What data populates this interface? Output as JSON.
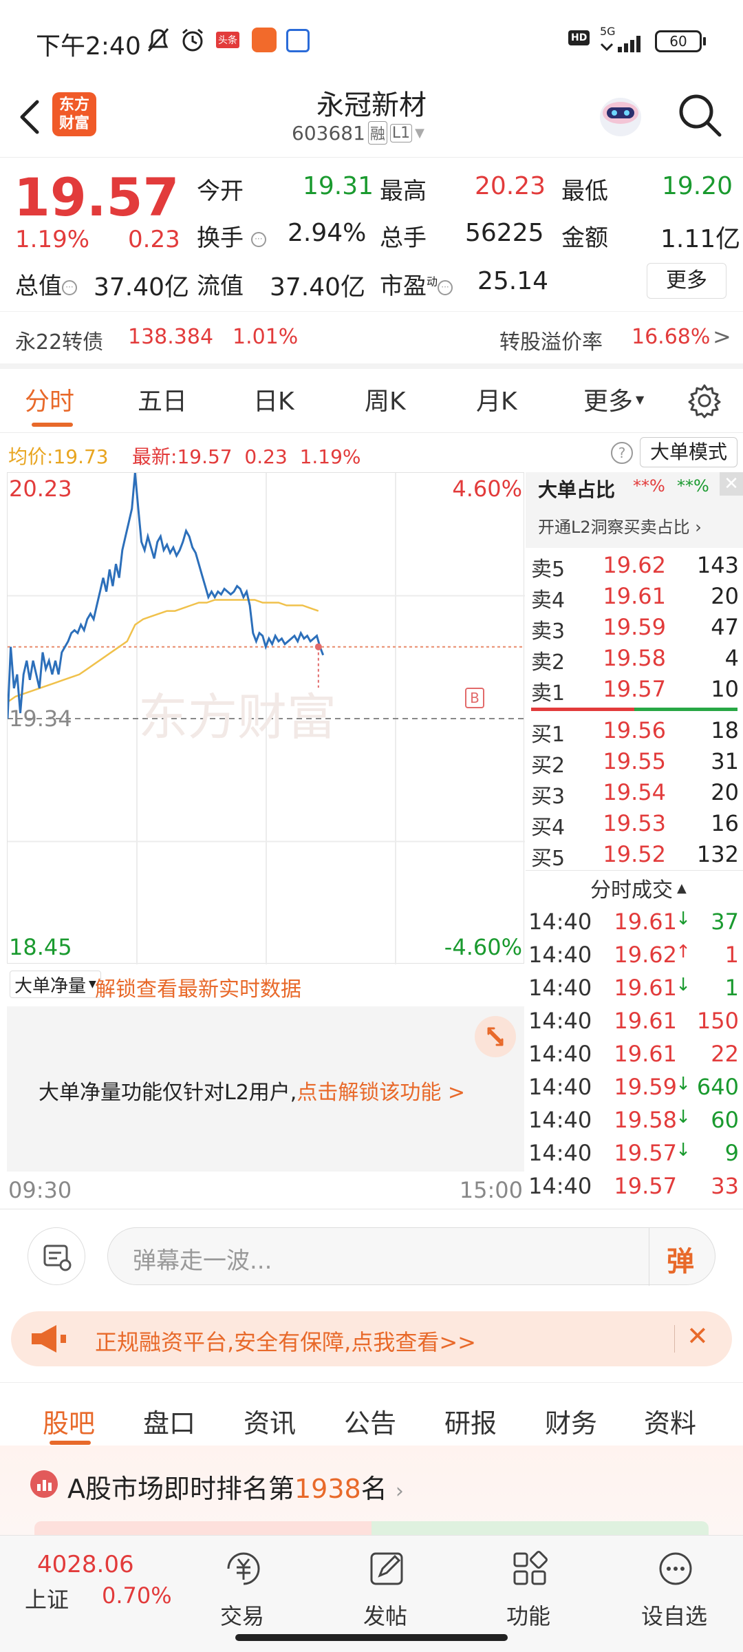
{
  "status_bar": {
    "time": "下午2:40",
    "app_badge1": "头条",
    "battery": "60",
    "network": "5G",
    "hd": "HD"
  },
  "header": {
    "logo_line1": "东方",
    "logo_line2": "财富",
    "title": "永冠新材",
    "code": "603681",
    "tag_rong": "融",
    "tag_l1": "L1"
  },
  "quote": {
    "price": "19.57",
    "change_pct": "1.19%",
    "change_amt": "0.23",
    "open_label": "今开",
    "open": "19.31",
    "high_label": "最高",
    "high": "20.23",
    "low_label": "最低",
    "low": "19.20",
    "turnover_label": "换手",
    "turnover": "2.94%",
    "volume_label": "总手",
    "volume": "56225",
    "amount_label": "金额",
    "amount": "1.11亿",
    "mktcap_label": "总值",
    "mktcap": "37.40亿",
    "float_label": "流值",
    "float": "37.40亿",
    "pe_label": "市盈",
    "pe_sup": "动",
    "pe": "25.14",
    "more_button": "更多"
  },
  "bond": {
    "name": "永22转债",
    "price": "138.384",
    "pct": "1.01%",
    "premium_label": "转股溢价率",
    "premium": "16.68%",
    "arrow": ">"
  },
  "chart_tabs": {
    "items": [
      "分时",
      "五日",
      "日K",
      "周K",
      "月K",
      "更多"
    ],
    "active": 0
  },
  "info_bar": {
    "avg_label": "均价:",
    "avg": "19.73",
    "latest_label": "最新:",
    "latest": "19.57",
    "chg": "0.23",
    "pct": "1.19%",
    "mode_button": "大单模式"
  },
  "intraday": {
    "top_price": "20.23",
    "top_pct": "4.60%",
    "bottom_price": "18.45",
    "bottom_pct": "-4.60%",
    "prev_close": "19.34",
    "start_time": "09:30",
    "end_time": "15:00",
    "watermark": "东方财富",
    "b_marker": "B"
  },
  "chart_data": {
    "type": "line",
    "ylim": [
      18.45,
      20.23
    ],
    "reference_line": 19.34,
    "series": [
      {
        "values": [
          19.34,
          19.6,
          19.45,
          19.5,
          19.36,
          19.5,
          19.55,
          19.48,
          19.55,
          19.5,
          19.45,
          19.58,
          19.52,
          19.55,
          19.5,
          19.55,
          19.5,
          19.58,
          19.6,
          19.62,
          19.65,
          19.66,
          19.65,
          19.68,
          19.66,
          19.7,
          19.72,
          19.7,
          19.75,
          19.8,
          19.85,
          19.8,
          19.88,
          19.82,
          19.9,
          19.85,
          19.95,
          20.0,
          20.05,
          20.1,
          20.23,
          20.1,
          19.98,
          19.95,
          20.0,
          19.96,
          19.92,
          19.98,
          20.0,
          19.95,
          19.97,
          19.94,
          19.96,
          19.93,
          19.95,
          19.98,
          20.02,
          20.0,
          19.96,
          19.94,
          19.9,
          19.86,
          19.82,
          19.78,
          19.8,
          19.78,
          19.8,
          19.79,
          19.81,
          19.8,
          19.79,
          19.8,
          19.82,
          19.81,
          19.78,
          19.8,
          19.75,
          19.65,
          19.62,
          19.65,
          19.64,
          19.6,
          19.63,
          19.61,
          19.64,
          19.62,
          19.63,
          19.61,
          19.62,
          19.63,
          19.64,
          19.62,
          19.65,
          19.63,
          19.64,
          19.62,
          19.63,
          19.64,
          19.6,
          19.57
        ]
      },
      {
        "values": [
          19.4,
          19.42,
          19.43,
          19.44,
          19.45,
          19.46,
          19.47,
          19.48,
          19.49,
          19.5,
          19.52,
          19.54,
          19.56,
          19.58,
          19.6,
          19.62,
          19.68,
          19.7,
          19.71,
          19.72,
          19.73,
          19.73,
          19.74,
          19.75,
          19.76,
          19.76,
          19.77,
          19.77,
          19.77,
          19.77,
          19.77,
          19.77,
          19.76,
          19.76,
          19.76,
          19.75,
          19.75,
          19.75,
          19.74,
          19.73
        ]
      }
    ]
  },
  "order_book": {
    "title": "大单占比",
    "red_pct": "**%",
    "green_pct": "**%",
    "l2_link": "开通L2洞察买卖占比",
    "asks": [
      {
        "label": "卖5",
        "price": "19.62",
        "vol": "143"
      },
      {
        "label": "卖4",
        "price": "19.61",
        "vol": "20"
      },
      {
        "label": "卖3",
        "price": "19.59",
        "vol": "47"
      },
      {
        "label": "卖2",
        "price": "19.58",
        "vol": "4"
      },
      {
        "label": "卖1",
        "price": "19.57",
        "vol": "10"
      }
    ],
    "bids": [
      {
        "label": "买1",
        "price": "19.56",
        "vol": "18"
      },
      {
        "label": "买2",
        "price": "19.55",
        "vol": "31"
      },
      {
        "label": "买3",
        "price": "19.54",
        "vol": "20"
      },
      {
        "label": "买4",
        "price": "19.53",
        "vol": "16"
      },
      {
        "label": "买5",
        "price": "19.52",
        "vol": "132"
      }
    ],
    "ticks_title": "分时成交",
    "ticks": [
      {
        "time": "14:40",
        "price": "19.61",
        "dir": "↓",
        "vol": "37"
      },
      {
        "time": "14:40",
        "price": "19.62",
        "dir": "↑",
        "vol": "1"
      },
      {
        "time": "14:40",
        "price": "19.61",
        "dir": "↓",
        "vol": "1"
      },
      {
        "time": "14:40",
        "price": "19.61",
        "dir": "",
        "vol": "150"
      },
      {
        "time": "14:40",
        "price": "19.61",
        "dir": "",
        "vol": "22"
      },
      {
        "time": "14:40",
        "price": "19.59",
        "dir": "↓",
        "vol": "640"
      },
      {
        "time": "14:40",
        "price": "19.58",
        "dir": "↓",
        "vol": "60"
      },
      {
        "time": "14:40",
        "price": "19.57",
        "dir": "↓",
        "vol": "9"
      },
      {
        "time": "14:40",
        "price": "19.57",
        "dir": "",
        "vol": "33"
      }
    ]
  },
  "netflow": {
    "dropdown": "大单净量",
    "unlock_text": "解锁查看最新实时数据",
    "notice": "大单净量功能仅针对L2用户,",
    "notice_link": "点击解锁该功能 >"
  },
  "danmu": {
    "placeholder": "弹幕走一波...",
    "button": "弹"
  },
  "ad": {
    "text": "正规融资平台,安全有保障,点我查看>>"
  },
  "bottom_tabs": {
    "items": [
      "股吧",
      "盘口",
      "资讯",
      "公告",
      "研报",
      "财务",
      "资料"
    ],
    "active": 0
  },
  "ranking": {
    "prefix": "A股市场即时排名第",
    "rank": "1938",
    "suffix": "名"
  },
  "nav": {
    "index_value": "4028.06",
    "index_name": "上证",
    "index_pct": "0.70%",
    "items": [
      "交易",
      "发帖",
      "功能",
      "设自选"
    ]
  }
}
